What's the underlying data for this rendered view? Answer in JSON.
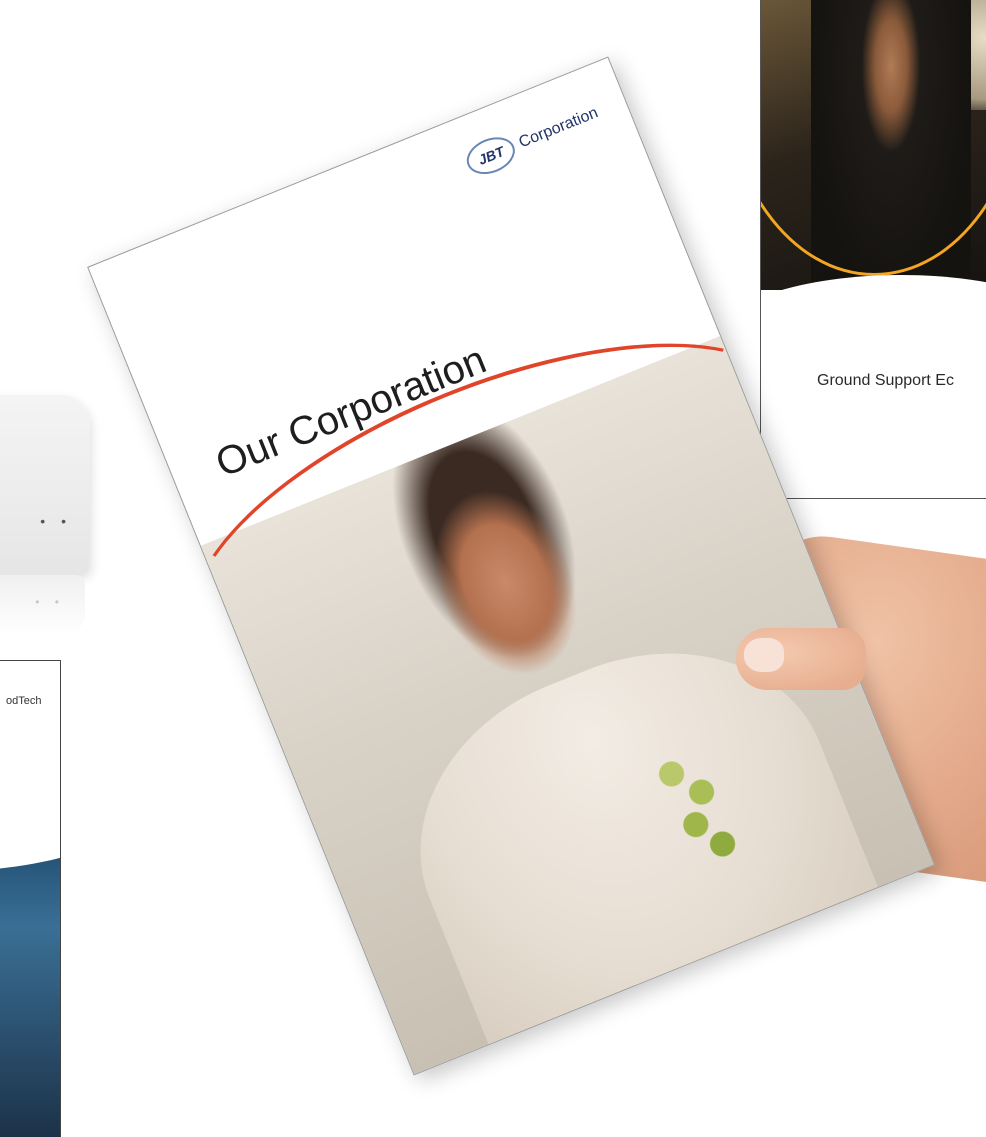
{
  "main_brochure": {
    "logo_mark": "JBT",
    "logo_text": "Corporation",
    "heading": "Our Corporation"
  },
  "ground_support_brochure": {
    "title": "Ground Support Ec"
  },
  "foodtech_brochure": {
    "title": "odTech"
  },
  "colors": {
    "accent_red": "#e0452a",
    "accent_orange": "#f2a623",
    "brand_blue": "#20336a"
  }
}
